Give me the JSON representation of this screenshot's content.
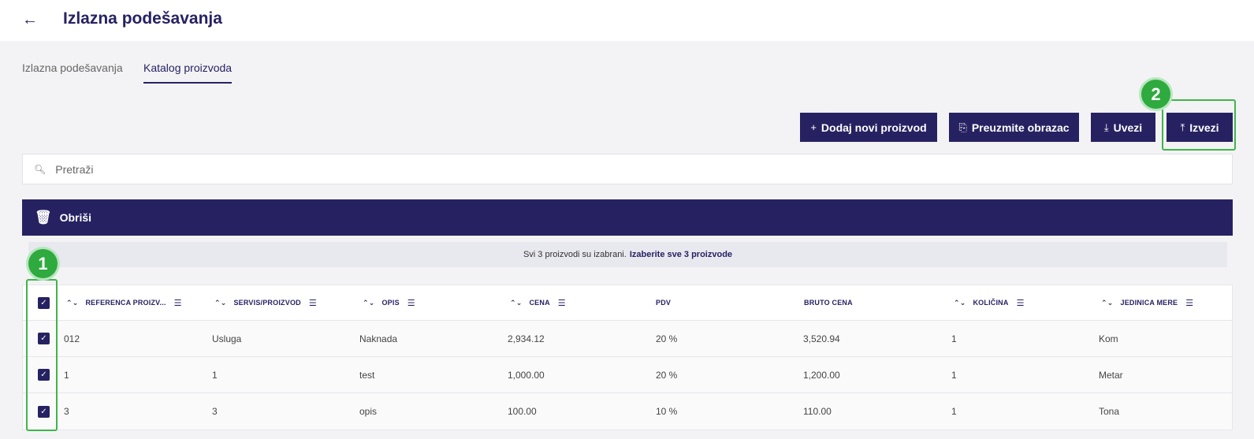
{
  "header": {
    "title": "Izlazna podešavanja",
    "back_icon": "←"
  },
  "tabs": [
    {
      "label": "Izlazna podešavanja",
      "active": false
    },
    {
      "label": "Katalog proizvoda",
      "active": true
    }
  ],
  "toolbar": {
    "add_label": "Dodaj novi proizvod",
    "download_label": "Preuzmite obrazac",
    "import_label": "Uvezi",
    "export_label": "Izvezi"
  },
  "markers": {
    "one": "1",
    "two": "2"
  },
  "search": {
    "placeholder": "Pretraži"
  },
  "delete_bar": {
    "label": "Obriši"
  },
  "selection": {
    "text": "Svi 3 proizvodi su izabrani.",
    "link": "Izaberite sve 3 proizvode"
  },
  "table": {
    "columns": [
      "REFERENCA PROIZV...",
      "SERVIS/PROIZVOD",
      "OPIS",
      "CENA",
      "PDV",
      "BRUTO CENA",
      "KOLIČINA",
      "JEDINICA MERE"
    ],
    "rows": [
      {
        "ref": "012",
        "service": "Usluga",
        "desc": "Naknada",
        "price": "2,934.12",
        "vat": "20 %",
        "gross": "3,520.94",
        "qty": "1",
        "unit": "Kom"
      },
      {
        "ref": "1",
        "service": "1",
        "desc": "test",
        "price": "1,000.00",
        "vat": "20 %",
        "gross": "1,200.00",
        "qty": "1",
        "unit": "Metar"
      },
      {
        "ref": "3",
        "service": "3",
        "desc": "opis",
        "price": "100.00",
        "vat": "10 %",
        "gross": "110.00",
        "qty": "1",
        "unit": "Tona"
      }
    ]
  },
  "colors": {
    "primary": "#262262",
    "highlight": "#3fb54a"
  }
}
